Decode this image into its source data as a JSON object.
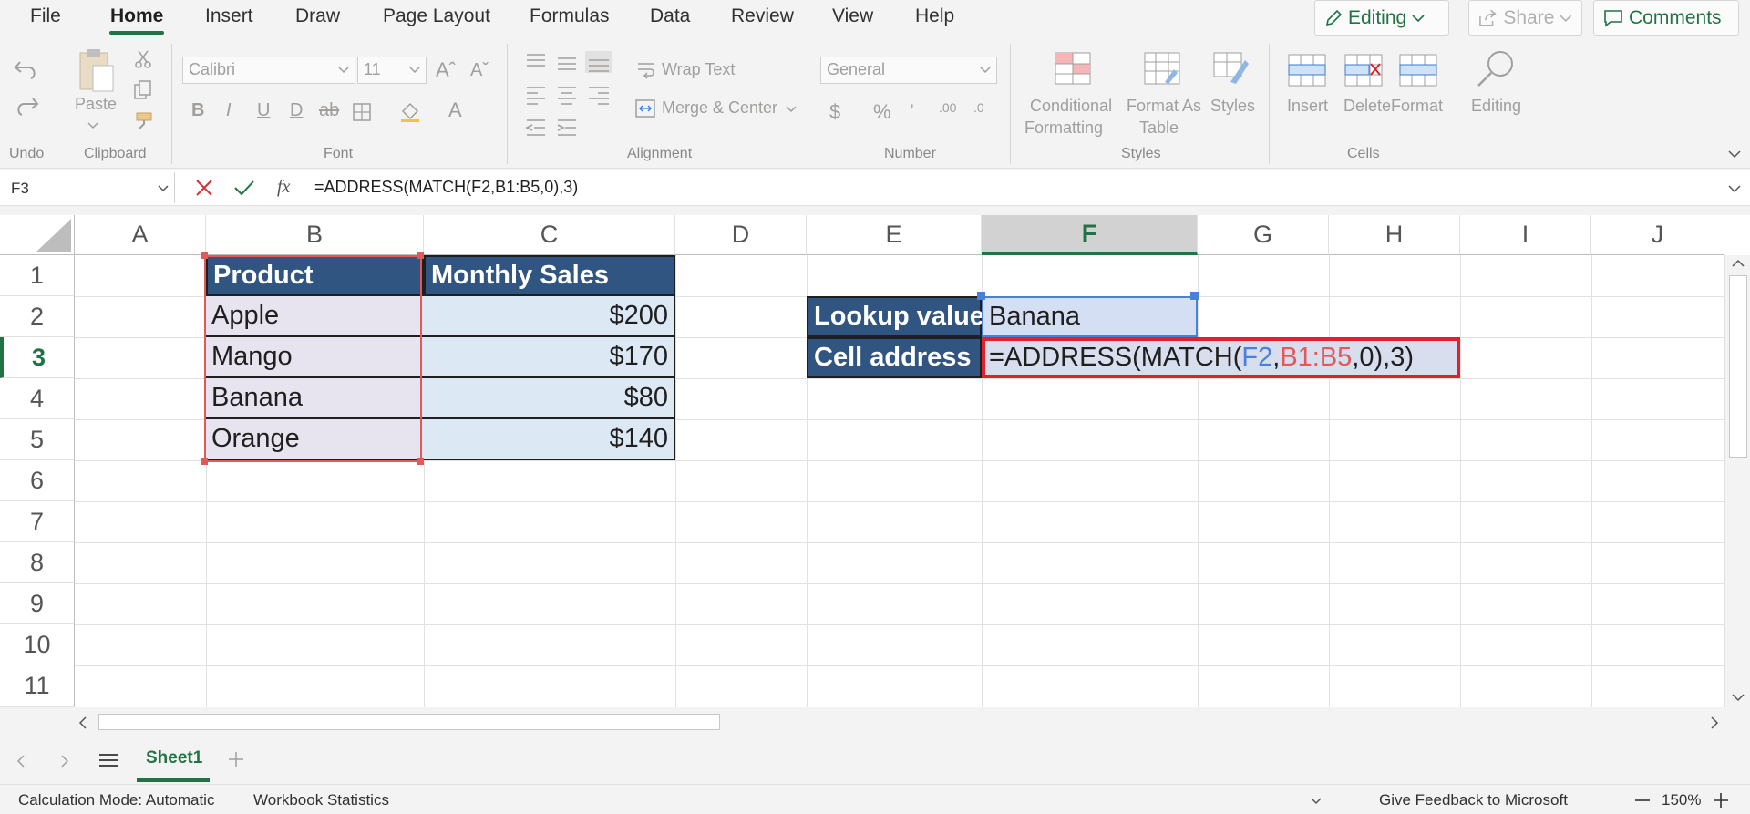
{
  "menu": {
    "tabs": [
      "File",
      "Home",
      "Insert",
      "Draw",
      "Page Layout",
      "Formulas",
      "Data",
      "Review",
      "View",
      "Help"
    ],
    "active": "Home",
    "editing_label": "Editing",
    "share_label": "Share",
    "comments_label": "Comments"
  },
  "ribbon": {
    "undo_group": "Undo",
    "clipboard_group": "Clipboard",
    "paste_label": "Paste",
    "font_group": "Font",
    "font_name": "Calibri",
    "font_size": "11",
    "alignment_group": "Alignment",
    "wrap_text": "Wrap Text",
    "merge_center": "Merge & Center",
    "number_group": "Number",
    "number_format": "General",
    "styles_group": "Styles",
    "conditional_formatting_1": "Conditional",
    "conditional_formatting_2": "Formatting",
    "format_as_table_1": "Format As",
    "format_as_table_2": "Table",
    "styles_label": "Styles",
    "cells_group": "Cells",
    "insert_label": "Insert",
    "delete_label": "Delete",
    "format_label": "Format",
    "editing_label": "Editing",
    "colors": {
      "accent": "#217346",
      "header_fill": "#2f5580",
      "highlight": "#e0202a"
    }
  },
  "formula_bar": {
    "name_box": "F3",
    "formula": "=ADDRESS(MATCH(F2,B1:B5,0),3)",
    "fx": "fx"
  },
  "grid": {
    "columns": [
      "A",
      "B",
      "C",
      "D",
      "E",
      "F",
      "G",
      "H",
      "I",
      "J"
    ],
    "rows": [
      "1",
      "2",
      "3",
      "4",
      "5",
      "6",
      "7",
      "8",
      "9",
      "10",
      "11"
    ],
    "selected_column": "F",
    "selected_row": "3",
    "table_headers": {
      "product": "Product",
      "monthly_sales": "Monthly Sales"
    },
    "products": [
      "Apple",
      "Mango",
      "Banana",
      "Orange"
    ],
    "sales": [
      "$200",
      "$170",
      "$80",
      "$140"
    ],
    "lookup_label": "Lookup value",
    "lookup_value": "Banana",
    "address_label": "Cell address",
    "formula_parts": {
      "p1": "=ADDRESS(MATCH(",
      "p2": "F2",
      "p3": ",",
      "p4": "B1:B5",
      "p5": ",0),3)"
    }
  },
  "sheets": {
    "active": "Sheet1"
  },
  "status": {
    "calc_mode": "Calculation Mode: Automatic",
    "workbook_stats": "Workbook Statistics",
    "feedback": "Give Feedback to Microsoft",
    "zoom": "150%"
  }
}
